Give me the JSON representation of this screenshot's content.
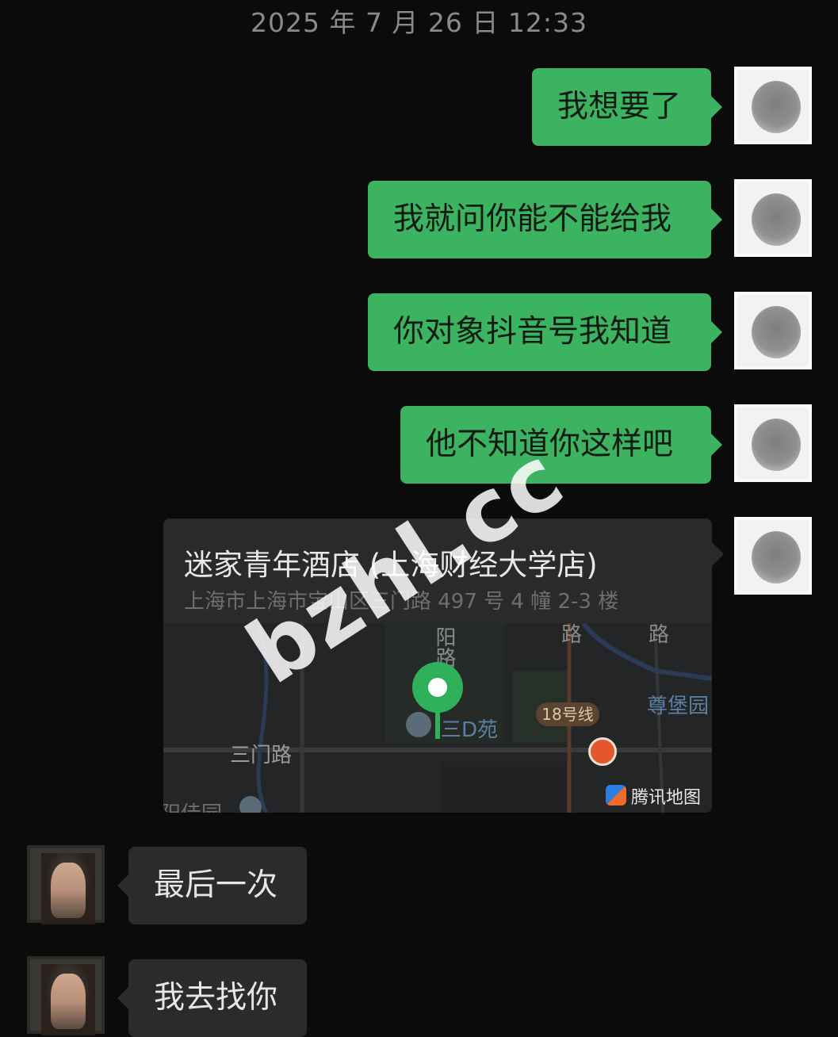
{
  "header": {
    "timestamp": "2025 年 7 月 26 日 12:33"
  },
  "messages": [
    {
      "side": "sent",
      "text": "我想要了"
    },
    {
      "side": "sent",
      "text": "我就问你能不能给我"
    },
    {
      "side": "sent",
      "text": "你对象抖音号我知道"
    },
    {
      "side": "sent",
      "text": "他不知道你这样吧"
    },
    {
      "side": "recv",
      "text": "最后一次"
    },
    {
      "side": "recv",
      "text": "我去找你"
    }
  ],
  "location_card": {
    "name": "迷家青年酒店 (上海财经大学店)",
    "address": "上海市上海市宝山区三门路 497 号 4 幢 2-3 楼",
    "map": {
      "road_vertical_1": "阳路",
      "road_top_2": "路",
      "road_top_3": "路",
      "area_1": "三D苑",
      "area_2": "尊堡园",
      "road_bottom": "三门路",
      "area_bottom": "阳佳园",
      "metro_badge": "18号线",
      "provider": "腾讯地图"
    }
  },
  "watermark": "bzhl.cc",
  "colors": {
    "sent_bubble": "#3cb361",
    "recv_bubble": "#2b2b2b",
    "background": "#0b0b0b",
    "pin": "#2fb05a"
  },
  "icons": [
    "person-avatar-icon",
    "map-pin-icon",
    "building-icon",
    "construction-icon",
    "tencent-map-logo-icon"
  ]
}
